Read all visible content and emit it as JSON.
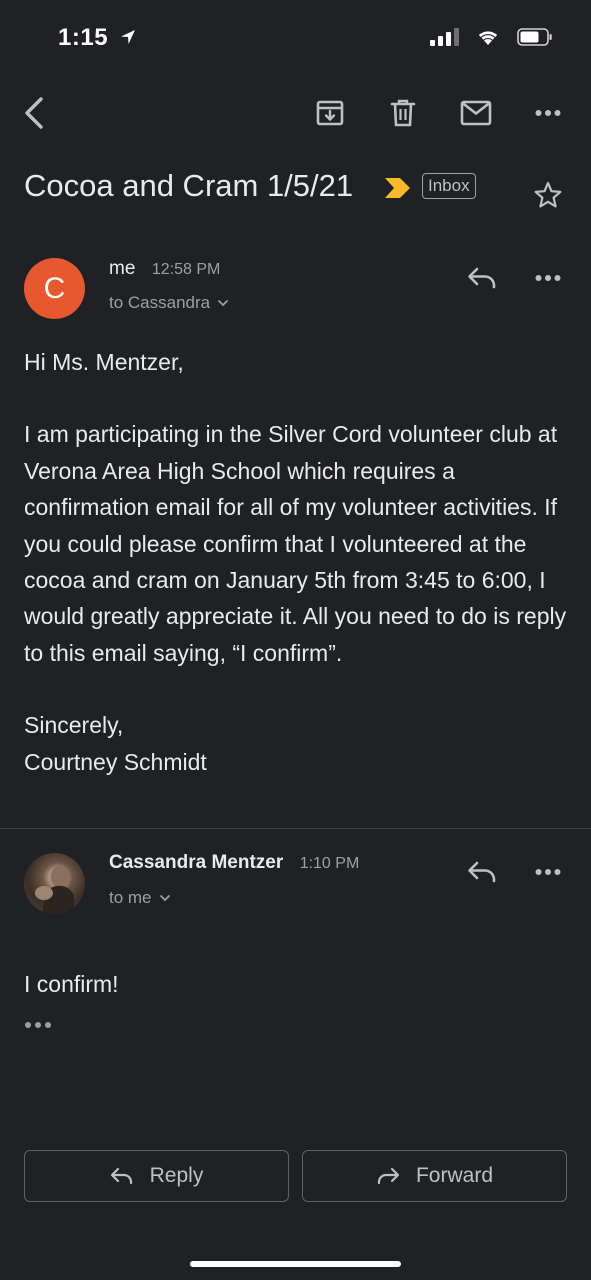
{
  "status_bar": {
    "time": "1:15"
  },
  "thread": {
    "subject": "Cocoa and Cram 1/5/21",
    "label": "Inbox"
  },
  "messages": [
    {
      "avatar_letter": "C",
      "sender": "me",
      "time": "12:58 PM",
      "to": "to Cassandra",
      "body": {
        "greeting": "Hi Ms. Mentzer,",
        "paragraph": "I am participating in the Silver Cord volunteer club at Verona Area High School which requires a confirmation email for all of my volunteer activities. If you could please confirm that I volunteered at the cocoa and cram on January 5th from 3:45 to 6:00, I would greatly appreciate it. All you need to do is reply to this email saying, “I confirm”.",
        "closing": "Sincerely,",
        "signature": "Courtney Schmidt"
      }
    },
    {
      "sender": "Cassandra Mentzer",
      "time": "1:10 PM",
      "to": "to me",
      "body": {
        "text": "I confirm!"
      }
    }
  ],
  "footer": {
    "reply_label": "Reply",
    "forward_label": "Forward"
  },
  "colors": {
    "background": "#202124",
    "avatar": "#e8582e",
    "important_marker": "#f9b826"
  }
}
